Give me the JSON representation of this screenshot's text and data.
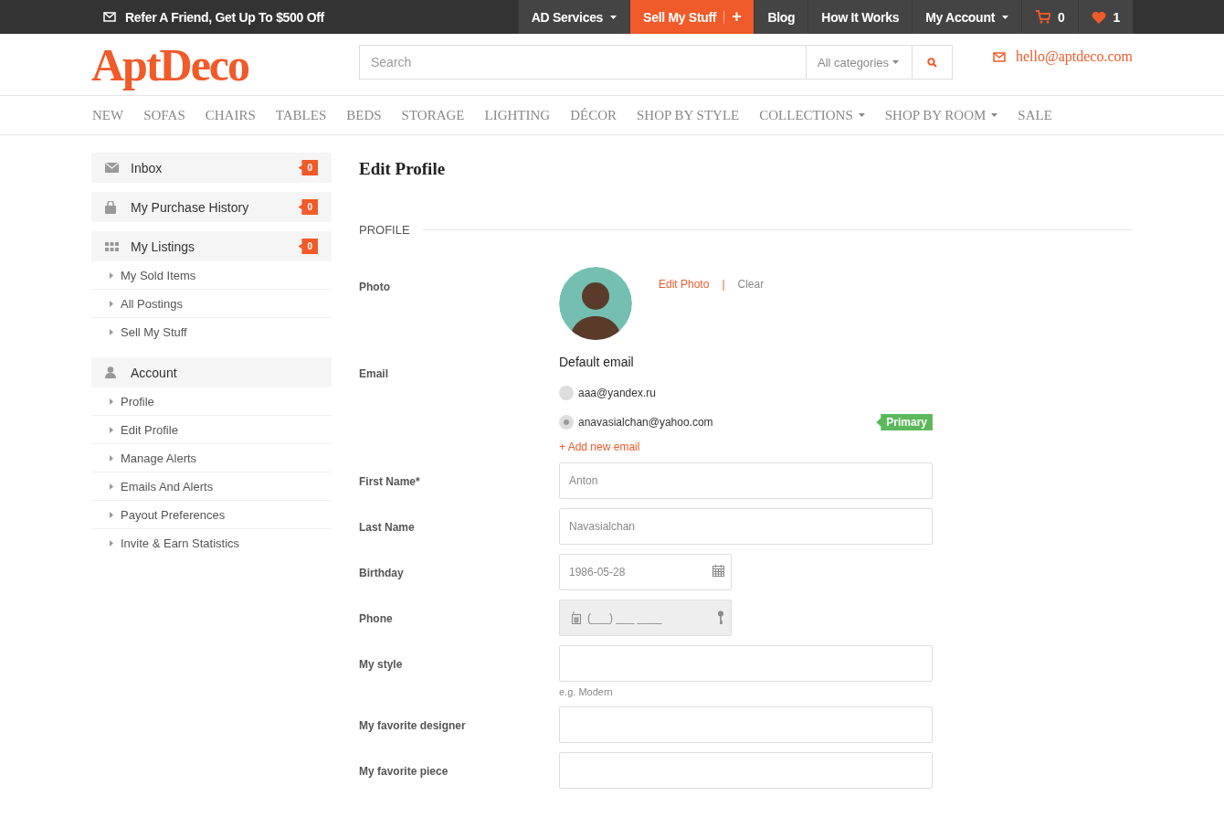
{
  "topbar": {
    "promo": "Refer A Friend, Get Up To $500 Off",
    "items": [
      {
        "label": "AD Services",
        "kind": "menu",
        "highlighted": false
      },
      {
        "label": "Sell My Stuff",
        "kind": "plus",
        "plus": "+",
        "highlighted": true
      },
      {
        "label": "Blog",
        "kind": "link",
        "highlighted": false
      },
      {
        "label": "How It Works",
        "kind": "link",
        "highlighted": false
      },
      {
        "label": "My Account",
        "kind": "menu",
        "highlighted": false
      },
      {
        "label": "0",
        "kind": "cart",
        "highlighted": false
      },
      {
        "label": "1",
        "kind": "heart",
        "highlighted": false
      }
    ]
  },
  "header": {
    "logo": "AptDeco",
    "search": {
      "placeholder": "Search"
    },
    "category": "All categories",
    "email": "hello@aptdeco.com"
  },
  "nav": [
    {
      "label": "NEW",
      "has_menu": false
    },
    {
      "label": "SOFAS",
      "has_menu": false
    },
    {
      "label": "CHAIRS",
      "has_menu": false
    },
    {
      "label": "TABLES",
      "has_menu": false
    },
    {
      "label": "BEDS",
      "has_menu": false
    },
    {
      "label": "STORAGE",
      "has_menu": false
    },
    {
      "label": "LIGHTING",
      "has_menu": false
    },
    {
      "label": "DÉCOR",
      "has_menu": false
    },
    {
      "label": "SHOP BY STYLE",
      "has_menu": false
    },
    {
      "label": "COLLECTIONS",
      "has_menu": true
    },
    {
      "label": "SHOP BY ROOM",
      "has_menu": true
    },
    {
      "label": "SALE",
      "has_menu": false
    }
  ],
  "sidebar": {
    "groups": [
      {
        "label": "Inbox",
        "badge": "0"
      },
      {
        "label": "My Purchase History",
        "badge": "0"
      },
      {
        "label": "My Listings",
        "badge": "0",
        "children": [
          "My Sold Items",
          "All Postings",
          "Sell My Stuff"
        ]
      },
      {
        "label": "Account",
        "children": [
          "Profile",
          "Edit Profile",
          "Manage Alerts",
          "Emails And Alerts",
          "Payout Preferences",
          "Invite & Earn Statistics"
        ]
      }
    ]
  },
  "main": {
    "title": "Edit Profile",
    "section": "PROFILE",
    "photo": {
      "label": "Photo",
      "edit": "Edit Photo",
      "separator": "|",
      "clear": "Clear"
    },
    "email": {
      "label": "Email",
      "heading": "Default email",
      "add": "+ Add new email",
      "options": [
        {
          "address": "aaa@yandex.ru",
          "selected": false
        },
        {
          "address": "anavasialchan@yahoo.com",
          "selected": true,
          "badge": "Primary"
        }
      ]
    },
    "fields": [
      {
        "label": "First Name*",
        "kind": "text",
        "value": "Anton",
        "wide": true
      },
      {
        "label": "Last Name",
        "kind": "text",
        "value": "Navasialchan",
        "wide": true
      },
      {
        "label": "Birthday",
        "kind": "date",
        "value": "1986-05-28",
        "wide": false
      },
      {
        "label": "Phone",
        "kind": "phone",
        "placeholder": "(___) ___ ____",
        "wide": false,
        "disabled": true
      },
      {
        "label": "My style",
        "kind": "text",
        "hint": "e.g. Modern",
        "wide": true
      },
      {
        "label": "My favorite designer",
        "kind": "text",
        "wide": true
      },
      {
        "label": "My favorite piece",
        "kind": "text",
        "wide": true
      }
    ]
  }
}
